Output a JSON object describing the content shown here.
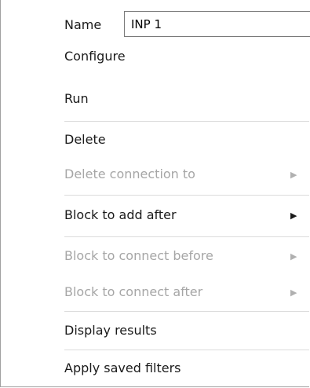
{
  "menu": {
    "name_label": "Name",
    "name_value": "INP 1",
    "items": [
      {
        "label": "Configure",
        "enabled": true,
        "submenu": false
      },
      {
        "label": "Run",
        "enabled": true,
        "submenu": false
      },
      {
        "label": "Delete",
        "enabled": true,
        "submenu": false
      },
      {
        "label": "Delete connection to",
        "enabled": false,
        "submenu": true
      },
      {
        "label": "Block to add after",
        "enabled": true,
        "submenu": true
      },
      {
        "label": "Block to connect before",
        "enabled": false,
        "submenu": true
      },
      {
        "label": "Block to connect after",
        "enabled": false,
        "submenu": true
      },
      {
        "label": "Display results",
        "enabled": true,
        "submenu": false
      },
      {
        "label": "Apply saved filters",
        "enabled": true,
        "submenu": false
      }
    ],
    "submenu_arrow_icon": "chevron-right-icon",
    "colors": {
      "text": "#1a1a1a",
      "disabled_text": "#a6a6a6",
      "separator": "#dcdcdc",
      "border": "#a0a0a0"
    }
  }
}
